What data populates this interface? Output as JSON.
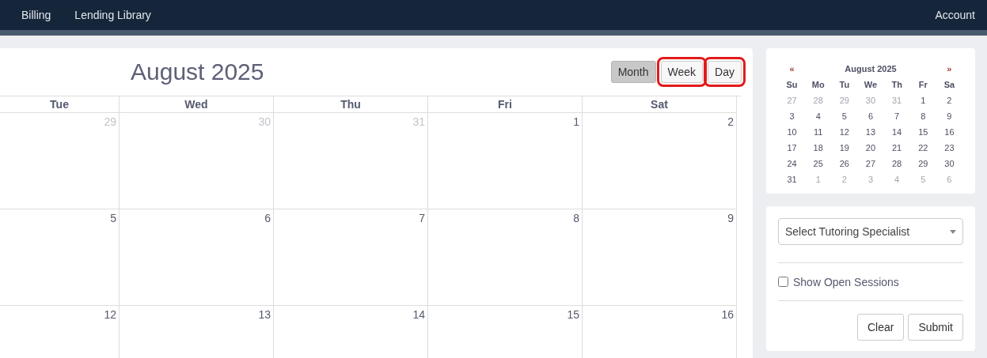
{
  "nav": {
    "links": [
      "Billing",
      "Lending Library"
    ],
    "account": "Account"
  },
  "calendar": {
    "title": "August 2025",
    "view_buttons": [
      {
        "label": "Month",
        "selected": true,
        "highlighted": false
      },
      {
        "label": "Week",
        "selected": false,
        "highlighted": true
      },
      {
        "label": "Day",
        "selected": false,
        "highlighted": true
      }
    ],
    "weekdays": [
      "Tue",
      "Wed",
      "Thu",
      "Fri",
      "Sat"
    ],
    "weeks": [
      [
        {
          "day": "29",
          "muted": true
        },
        {
          "day": "30",
          "muted": true
        },
        {
          "day": "31",
          "muted": true
        },
        {
          "day": "1",
          "muted": false
        },
        {
          "day": "2",
          "muted": false
        }
      ],
      [
        {
          "day": "5",
          "muted": false
        },
        {
          "day": "6",
          "muted": false
        },
        {
          "day": "7",
          "muted": false
        },
        {
          "day": "8",
          "muted": false
        },
        {
          "day": "9",
          "muted": false
        }
      ],
      [
        {
          "day": "12",
          "muted": false
        },
        {
          "day": "13",
          "muted": false
        },
        {
          "day": "14",
          "muted": false
        },
        {
          "day": "15",
          "muted": false
        },
        {
          "day": "16",
          "muted": false
        }
      ]
    ]
  },
  "mini_calendar": {
    "prev": "«",
    "title": "August 2025",
    "next": "»",
    "weekdays": [
      "Su",
      "Mo",
      "Tu",
      "We",
      "Th",
      "Fr",
      "Sa"
    ],
    "weeks": [
      [
        {
          "day": "27",
          "muted": true
        },
        {
          "day": "28",
          "muted": true
        },
        {
          "day": "29",
          "muted": true
        },
        {
          "day": "30",
          "muted": true
        },
        {
          "day": "31",
          "muted": true
        },
        {
          "day": "1",
          "muted": false
        },
        {
          "day": "2",
          "muted": false
        }
      ],
      [
        {
          "day": "3",
          "muted": false
        },
        {
          "day": "4",
          "muted": false
        },
        {
          "day": "5",
          "muted": false
        },
        {
          "day": "6",
          "muted": false
        },
        {
          "day": "7",
          "muted": false
        },
        {
          "day": "8",
          "muted": false
        },
        {
          "day": "9",
          "muted": false
        }
      ],
      [
        {
          "day": "10",
          "muted": false
        },
        {
          "day": "11",
          "muted": false
        },
        {
          "day": "12",
          "muted": false
        },
        {
          "day": "13",
          "muted": false
        },
        {
          "day": "14",
          "muted": false
        },
        {
          "day": "15",
          "muted": false
        },
        {
          "day": "16",
          "muted": false
        }
      ],
      [
        {
          "day": "17",
          "muted": false
        },
        {
          "day": "18",
          "muted": false
        },
        {
          "day": "19",
          "muted": false
        },
        {
          "day": "20",
          "muted": false
        },
        {
          "day": "21",
          "muted": false
        },
        {
          "day": "22",
          "muted": false
        },
        {
          "day": "23",
          "muted": false
        }
      ],
      [
        {
          "day": "24",
          "muted": false
        },
        {
          "day": "25",
          "muted": false
        },
        {
          "day": "26",
          "muted": false
        },
        {
          "day": "27",
          "muted": false
        },
        {
          "day": "28",
          "muted": false
        },
        {
          "day": "29",
          "muted": false
        },
        {
          "day": "30",
          "muted": false
        }
      ],
      [
        {
          "day": "31",
          "muted": false
        },
        {
          "day": "1",
          "muted": true
        },
        {
          "day": "2",
          "muted": true
        },
        {
          "day": "3",
          "muted": true
        },
        {
          "day": "4",
          "muted": true
        },
        {
          "day": "5",
          "muted": true
        },
        {
          "day": "6",
          "muted": true
        }
      ]
    ]
  },
  "filter": {
    "specialist_select": {
      "placeholder": "Select Tutoring Specialist"
    },
    "show_open_sessions": {
      "label": "Show Open Sessions",
      "checked": false
    },
    "buttons": [
      "Clear",
      "Submit"
    ]
  }
}
